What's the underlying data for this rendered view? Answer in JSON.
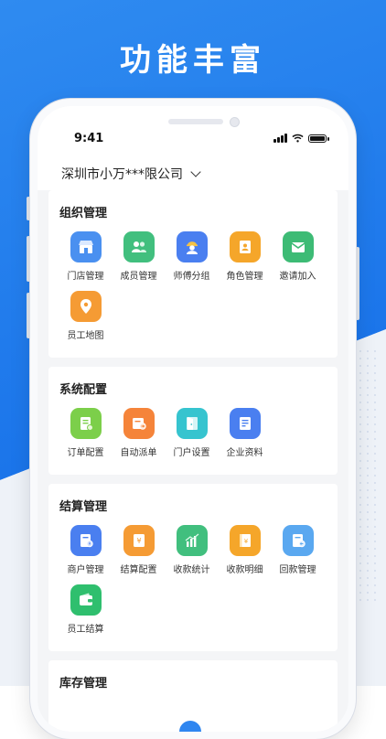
{
  "hero": {
    "title": "功能丰富"
  },
  "status": {
    "time": "9:41"
  },
  "company": {
    "name": "深圳市小万***限公司"
  },
  "sections": [
    {
      "title": "组织管理",
      "items": [
        {
          "label": "门店管理",
          "icon": "store-icon",
          "color": "#4a90f0"
        },
        {
          "label": "成员管理",
          "icon": "members-icon",
          "color": "#41bf7e"
        },
        {
          "label": "师傅分组",
          "icon": "worker-icon",
          "color": "#4a7ff0"
        },
        {
          "label": "角色管理",
          "icon": "role-card-icon",
          "color": "#f5a62a"
        },
        {
          "label": "邀请加入",
          "icon": "invite-mail-icon",
          "color": "#3dbb75"
        },
        {
          "label": "员工地图",
          "icon": "map-pin-icon",
          "color": "#f59b34"
        }
      ]
    },
    {
      "title": "系统配置",
      "items": [
        {
          "label": "订单配置",
          "icon": "order-config-icon",
          "color": "#7ccf4a"
        },
        {
          "label": "自动派单",
          "icon": "auto-dispatch-icon",
          "color": "#f5843a"
        },
        {
          "label": "门户设置",
          "icon": "portal-door-icon",
          "color": "#36c4cf"
        },
        {
          "label": "企业资料",
          "icon": "company-doc-icon",
          "color": "#4a7ff0"
        }
      ]
    },
    {
      "title": "结算管理",
      "items": [
        {
          "label": "商户管理",
          "icon": "merchant-icon",
          "color": "#4a7ff0"
        },
        {
          "label": "结算配置",
          "icon": "settlement-config-icon",
          "color": "#f59b34"
        },
        {
          "label": "收款统计",
          "icon": "stats-chart-icon",
          "color": "#41bf7e"
        },
        {
          "label": "收款明细",
          "icon": "receipt-detail-icon",
          "color": "#f5a62a"
        },
        {
          "label": "回款管理",
          "icon": "refund-icon",
          "color": "#5aa8f0"
        },
        {
          "label": "员工结算",
          "icon": "wallet-icon",
          "color": "#2fbf6e"
        }
      ]
    }
  ],
  "partial_section": {
    "title": "库存管理"
  }
}
